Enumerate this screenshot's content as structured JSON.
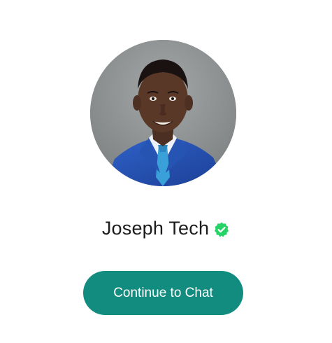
{
  "profile": {
    "name": "Joseph Tech",
    "verified_icon": "verified-check-icon",
    "avatar": "profile-photo"
  },
  "actions": {
    "continue_label": "Continue to Chat"
  },
  "colors": {
    "accent": "#128c7e",
    "verified": "#25d366",
    "text": "#1c1c1c",
    "background": "#ffffff"
  }
}
